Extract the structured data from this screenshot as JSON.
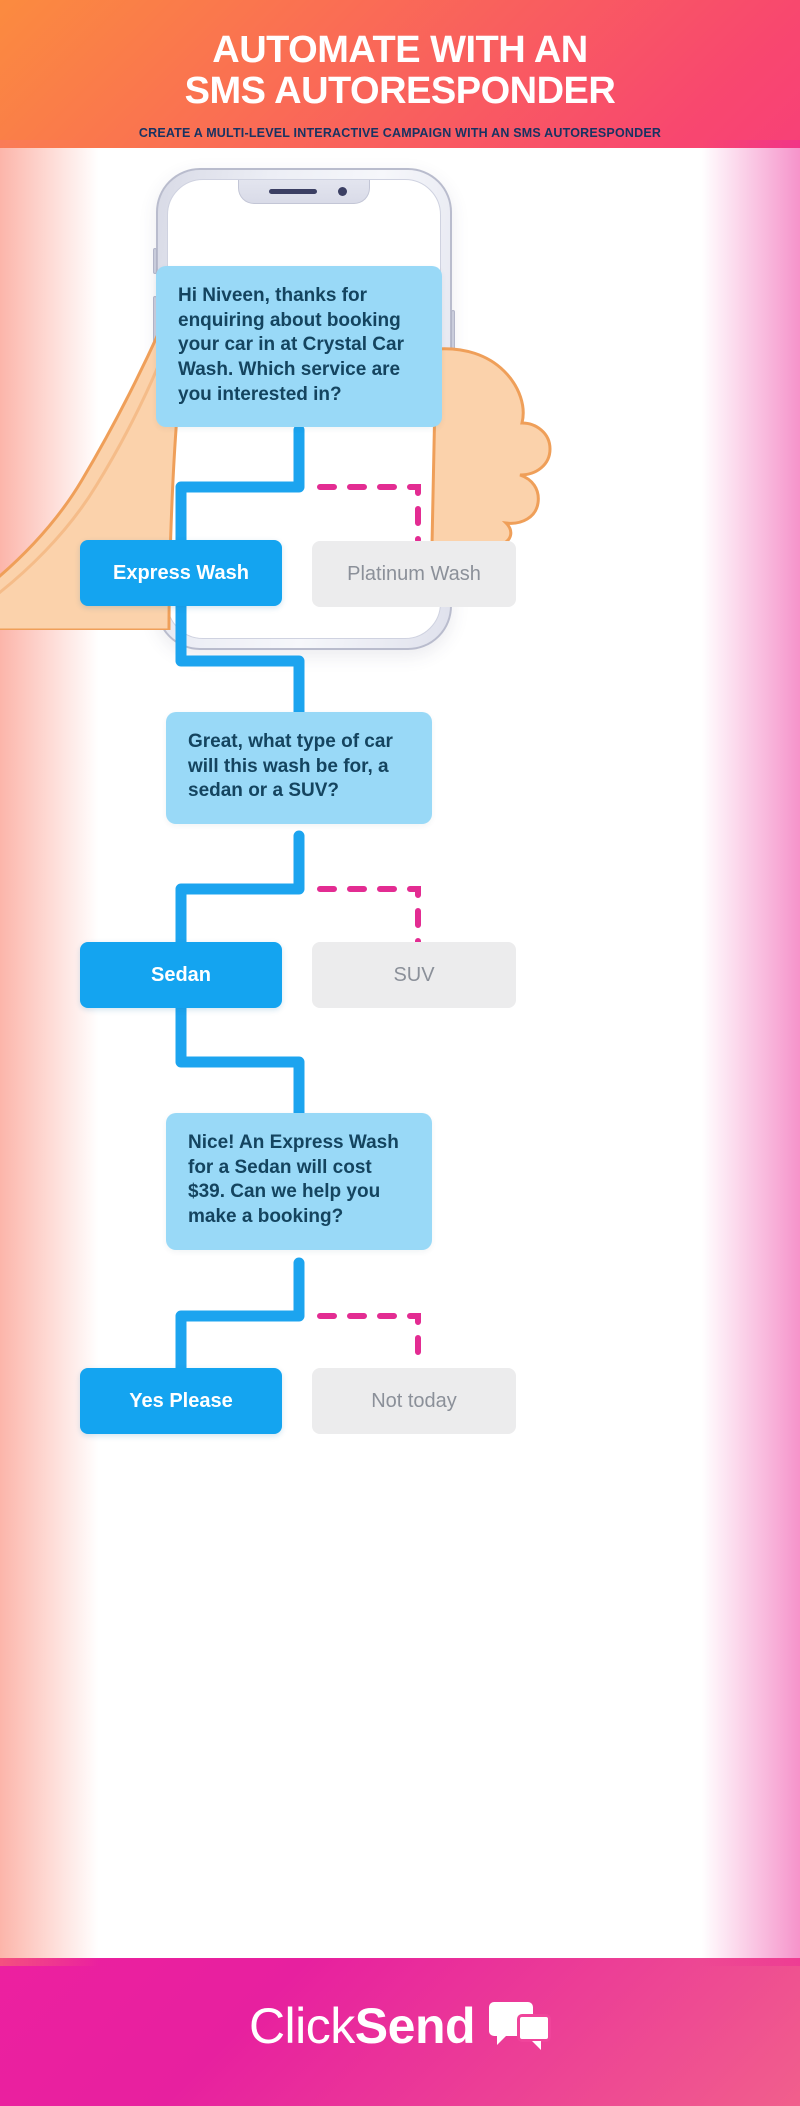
{
  "header": {
    "title_line1": "AUTOMATE WITH AN",
    "title_line2": "SMS AUTORESPONDER",
    "subtitle": "CREATE A MULTI-LEVEL INTERACTIVE CAMPAIGN WITH AN SMS AUTORESPONDER"
  },
  "colors": {
    "bubble_bg": "#99d9f7",
    "bubble_text": "#14445f",
    "primary_button": "#14a4f0",
    "secondary_button": "#ececed",
    "secondary_text": "#8b9099",
    "connector_blue": "#1ca4ef",
    "connector_pink": "#e32c92",
    "brand_pink": "#f0449b",
    "subtitle_navy": "#173362"
  },
  "flow": {
    "messages": [
      {
        "id": "message-1",
        "text": "Hi Niveen, thanks for enquiring about booking your car in at Crystal Car Wash. Which service are you interested in?"
      },
      {
        "id": "message-2",
        "text": "Great, what type of car will this wash be for, a sedan or a SUV?"
      },
      {
        "id": "message-3",
        "text": "Nice! An Express Wash for a Sedan will cost $39. Can we help you make a booking?"
      }
    ],
    "choices": [
      {
        "id": "choice-row-1",
        "selected": "Express Wash",
        "alternate": "Platinum Wash"
      },
      {
        "id": "choice-row-2",
        "selected": "Sedan",
        "alternate": "SUV"
      },
      {
        "id": "choice-row-3",
        "selected": "Yes Please",
        "alternate": "Not today"
      }
    ]
  },
  "footer": {
    "logo_part1": "Click",
    "logo_part2": "Send"
  }
}
